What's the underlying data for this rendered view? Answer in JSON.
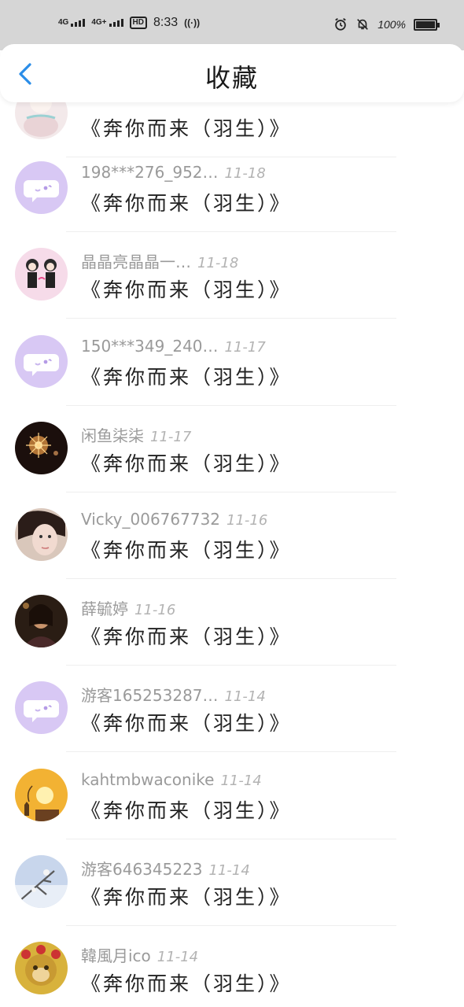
{
  "status_bar": {
    "signal1": "4G",
    "signal2": "4G+",
    "hd": "HD",
    "time": "8:33",
    "battery": "100%"
  },
  "header": {
    "title": "收藏"
  },
  "colors": {
    "accent": "#2a8de8",
    "placeholder_avatar_bg": "#d8c8f4",
    "placeholder_avatar_fg": "#ffffff"
  },
  "items": [
    {
      "user": "",
      "date": "",
      "song": "《奔你而来（羽生）》",
      "avatar": "cartoon"
    },
    {
      "user": "198***276_952…",
      "date": "11-18",
      "song": "《奔你而来（羽生）》",
      "avatar": "chat-placeholder"
    },
    {
      "user": "晶晶亮晶晶一…",
      "date": "11-18",
      "song": "《奔你而来（羽生）》",
      "avatar": "couple-cartoon"
    },
    {
      "user": "150***349_240…",
      "date": "11-17",
      "song": "《奔你而来（羽生）》",
      "avatar": "chat-placeholder"
    },
    {
      "user": "闲鱼柒柒",
      "date": "11-17",
      "song": "《奔你而来（羽生）》",
      "avatar": "sparkler"
    },
    {
      "user": "Vicky_006767732",
      "date": "11-16",
      "song": "《奔你而来（羽生）》",
      "avatar": "portrait"
    },
    {
      "user": "薛毓婷",
      "date": "11-16",
      "song": "《奔你而来（羽生）》",
      "avatar": "dark-portrait"
    },
    {
      "user": "游客165253287…",
      "date": "11-14",
      "song": "《奔你而来（羽生）》",
      "avatar": "chat-placeholder"
    },
    {
      "user": "kahtmbwaconike",
      "date": "11-14",
      "song": "《奔你而来（羽生）》",
      "avatar": "sunset"
    },
    {
      "user": "游客646345223",
      "date": "11-14",
      "song": "《奔你而来（羽生）》",
      "avatar": "winter-branch"
    },
    {
      "user": "韓風月ico",
      "date": "11-14",
      "song": "《奔你而来（羽生）》",
      "avatar": "monkey-king"
    }
  ]
}
